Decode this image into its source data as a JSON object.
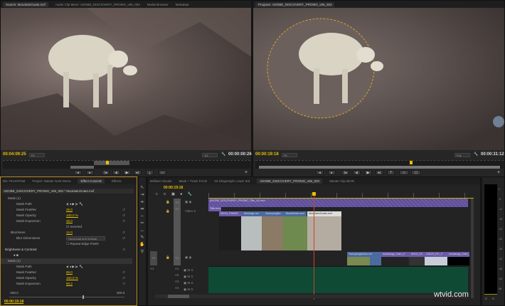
{
  "source_monitor": {
    "tabs": [
      "Source: MountainGoats.mxf",
      "Audio Clip Mixer: ADOBE_DISCOVERY_PROMO_v06_003",
      "Media Browser",
      "Metadata"
    ],
    "timecode_current": "00:04:09:25",
    "fit": "Fit",
    "resolution": "1/2",
    "timecode_duration": "00:00:00:26"
  },
  "program_monitor": {
    "tabs": [
      "Program: ADOBE_DISCOVERY_PROMO_v06_003"
    ],
    "timecode_current": "00:00:19:18",
    "fit": "Fit",
    "resolution": "Full",
    "timecode_duration": "00:00:31:12"
  },
  "effect_controls": {
    "tabs": [
      "Bin: PHANTOM",
      "Project: Master NAB Demo",
      "Effect Controls",
      "Effects"
    ],
    "clip_path": "ADOBE_DISCOVERY_PROMO_v06_003 * MountainGoats.mxf",
    "rows": [
      {
        "label": "Mask (1)",
        "value": ""
      },
      {
        "label": "Mask Path",
        "value": ""
      },
      {
        "label": "Mask Feather",
        "value": "26.0"
      },
      {
        "label": "Mask Opacity",
        "value": "100.0 %"
      },
      {
        "label": "Mask Expansion",
        "value": "45.0"
      },
      {
        "label": "",
        "value": "Inverted"
      },
      {
        "label": "Blurriness",
        "value": "12.0"
      },
      {
        "label": "Blur Dimensions",
        "value": "Horizontal and Vertical"
      },
      {
        "label": "",
        "value": "Repeat Edge Pixels"
      },
      {
        "label": "Brightness & Contrast",
        "value": ""
      },
      {
        "label": "Mask (1)",
        "value": ""
      },
      {
        "label": "Mask Path",
        "value": ""
      },
      {
        "label": "Mask Feather",
        "value": "69.0"
      },
      {
        "label": "Mask Opacity",
        "value": "100.0 %"
      },
      {
        "label": "Mask Expansion",
        "value": "80.2"
      }
    ],
    "slider_min": "-300.0",
    "slider_max": "300.0",
    "slider_value": 80.2,
    "timecode": "00:00:19:18"
  },
  "timeline": {
    "tabs": [
      "Brilliant Visuals",
      "Mask + Track FACE",
      "03 Shapestyle Lower 3rd",
      "ADOBE_DISCOVERY_PROMO_v06_003",
      "Master Clip BION"
    ],
    "timecode": "00:00:19:18",
    "v3_clip": "ADOBE_DISCOVERY_PROMO_Title_v3.mov",
    "v3_sub": "Title.mov",
    "v2_label": "Video 2",
    "v2_clips": [
      "M2S4_PHANT",
      "Montage.mx",
      "SwoopingAd",
      "BlackBearLand",
      "MountainGoats.mxf"
    ],
    "v1_clips": [
      "SwoopingAction.mx",
      "mustangs_Cam_C",
      "A013_C0",
      "C8123_RC_2",
      "mustangs_Cam_9504"
    ],
    "video_tracks": [
      "V3",
      "V2",
      "V1"
    ],
    "audio_tracks": [
      "A1",
      "A2",
      "A3",
      "A4"
    ],
    "source_patch_v": "V1",
    "source_patch_a": "A1"
  },
  "audio_meter": {
    "scale": [
      "0",
      "-6",
      "-12",
      "-18",
      "-24",
      "-30",
      "-36",
      "-42",
      "-48",
      "-54",
      "dB"
    ],
    "channels": [
      "S",
      "S"
    ]
  },
  "watermark": "wtvid.com",
  "colors": {
    "accent": "#e8c000",
    "purple_clip": "#6b5aa8",
    "audio_track": "#0f4a35",
    "playhead": "#c8452c"
  }
}
